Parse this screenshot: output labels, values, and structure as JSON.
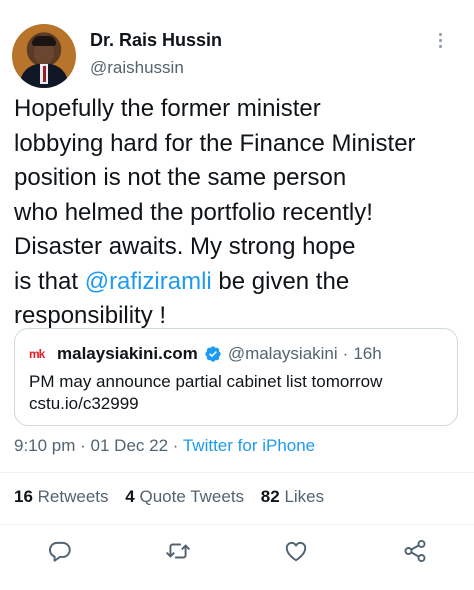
{
  "author": {
    "name": "Dr. Rais Hussin",
    "handle": "@raishussin"
  },
  "tweet": {
    "lines": [
      "Hopefully the former minister",
      "lobbying hard for the Finance Minister",
      "position is not the same person",
      "who helmed the portfolio recently!",
      "Disaster awaits. My strong hope"
    ],
    "line6_prefix": "is that ",
    "mention": "@rafiziramli",
    "line6_suffix": " be given the",
    "line7": "responsibility !"
  },
  "quote": {
    "logo_text": "mk",
    "name": "malaysiakini.com",
    "handle": "@malaysiakini",
    "separator": "·",
    "time": "16h",
    "text": "PM may announce partial cabinet list tomorrow",
    "link": "cstu.io/c32999"
  },
  "meta": {
    "time": "9:10 pm",
    "sep1": " · ",
    "date": "01 Dec 22",
    "sep2": " · ",
    "source": "Twitter for iPhone"
  },
  "stats": {
    "retweets_count": "16",
    "retweets_label": "Retweets",
    "quotes_count": "4",
    "quotes_label": "Quote Tweets",
    "likes_count": "82",
    "likes_label": "Likes"
  },
  "icons": {
    "more": "more-vertical-icon",
    "reply": "reply-icon",
    "retweet": "retweet-icon",
    "like": "heart-icon",
    "share": "share-icon",
    "verified": "verified-badge-icon"
  },
  "colors": {
    "accent": "#1d9bf0",
    "secondary_text": "#536471",
    "primary_text": "#0f1419",
    "brand_red": "#e02028"
  }
}
